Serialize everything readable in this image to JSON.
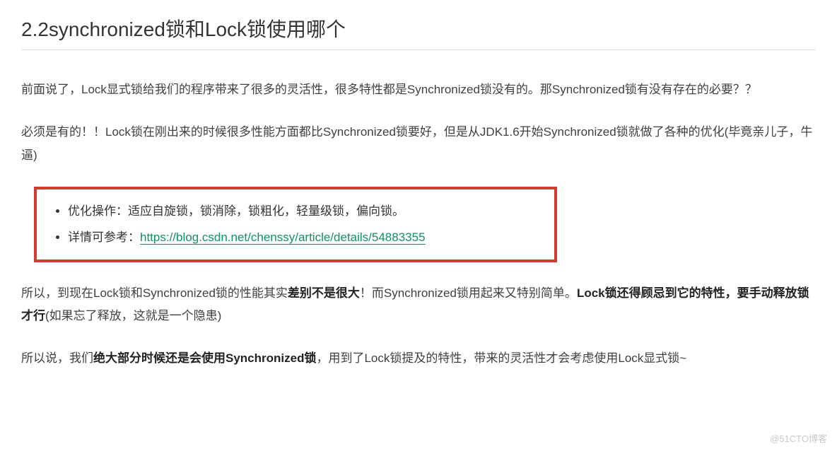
{
  "heading": "2.2synchronized锁和Lock锁使用哪个",
  "para1": "前面说了，Lock显式锁给我们的程序带来了很多的灵活性，很多特性都是Synchronized锁没有的。那Synchronized锁有没有存在的必要？？",
  "para2": "必须是有的！！Lock锁在刚出来的时候很多性能方面都比Synchronized锁要好，但是从JDK1.6开始Synchronized锁就做了各种的优化(毕竟亲儿子，牛逼)",
  "box": {
    "item1": "优化操作：适应自旋锁，锁消除，锁粗化，轻量级锁，偏向锁。",
    "item2_prefix": "详情可参考：",
    "item2_link": "https://blog.csdn.net/chenssy/article/details/54883355"
  },
  "para3": {
    "t1": "所以，到现在Lock锁和Synchronized锁的性能其实",
    "b1": "差别不是很大",
    "t2": "！而Synchronized锁用起来又特别简单。",
    "b2": "Lock锁还得顾忌到它的特性，要手动释放锁才行",
    "t3": "(如果忘了释放，这就是一个隐患)"
  },
  "para4": {
    "t1": "所以说，我们",
    "b1": "绝大部分时候还是会使用Synchronized锁",
    "t2": "，用到了Lock锁提及的特性，带来的灵活性才会考虑使用Lock显式锁~"
  },
  "watermark": "@51CTO博客"
}
